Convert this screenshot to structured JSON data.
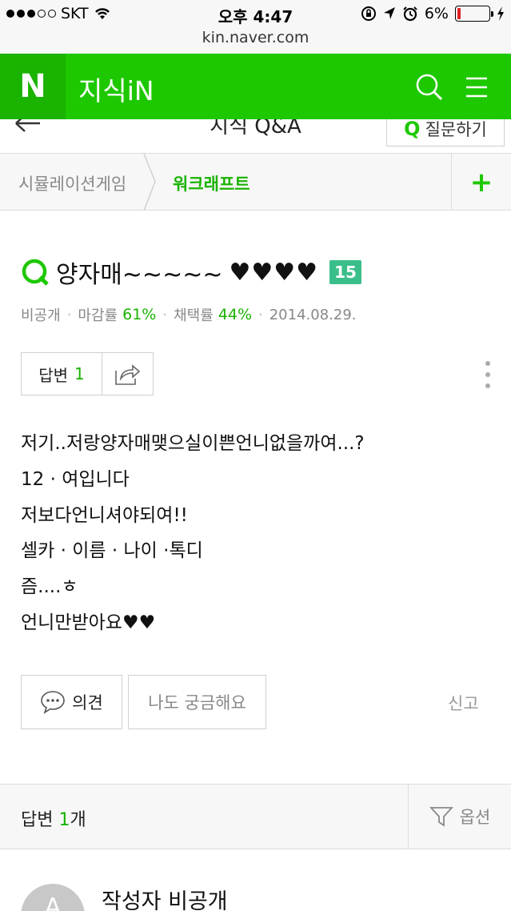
{
  "status_bar": {
    "carrier": "SKT",
    "time": "오후 4:47",
    "battery": "6%"
  },
  "url": "kin.naver.com",
  "header": {
    "logo": "N",
    "title": "지식iN"
  },
  "sub_header": {
    "title": "지식 Q&A",
    "ask_icon": "Q",
    "ask_label": "질문하기"
  },
  "breadcrumb": {
    "parent": "시뮬레이션게임",
    "current": "워크래프트",
    "add": "+"
  },
  "question": {
    "title": "양자매~~~~~",
    "hearts": "♥♥♥♥",
    "level": "15",
    "meta": {
      "visibility": "비공개",
      "close_label": "마감률",
      "close_rate": "61%",
      "adopt_label": "채택률",
      "adopt_rate": "44%",
      "date": "2014.08.29."
    },
    "answer_label": "답변",
    "answer_count": "1",
    "body_lines": [
      "저기..저랑양자매맺으실이쁜언니없을까여...?",
      "12 · 여입니다",
      "저보다언니셔야되여!!",
      "셀카 · 이름 · 나이 ·톡디",
      "즘....ㅎ",
      "언니만받아요♥♥"
    ]
  },
  "actions": {
    "opinion": "의견",
    "curious": "나도 궁금해요",
    "report": "신고"
  },
  "answers_bar": {
    "label": "답변",
    "count": "1",
    "unit": "개",
    "options": "옵션"
  },
  "author": {
    "avatar_letter": "A",
    "name": "작성자 비공개"
  },
  "colors": {
    "brand_green": "#1ec800",
    "dark_green": "#19b300",
    "badge": "#3bbf8a"
  }
}
